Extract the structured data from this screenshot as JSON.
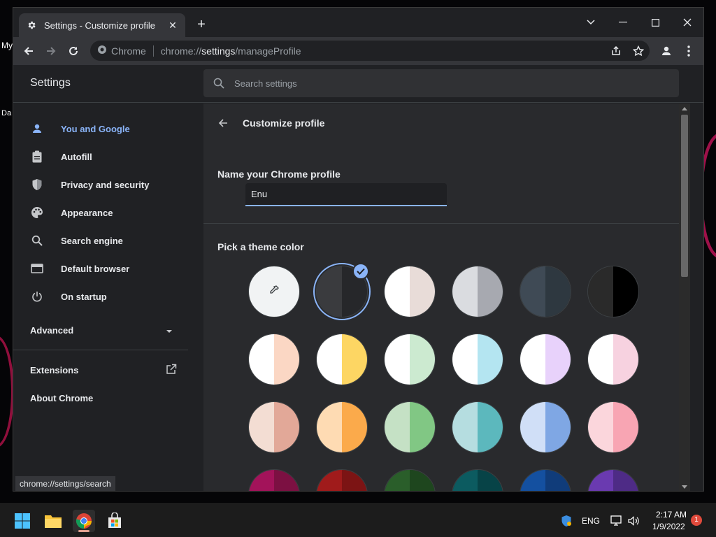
{
  "desktop": {
    "label_a": "My",
    "label_b": "Da"
  },
  "browser": {
    "tab_title": "Settings - Customize profile",
    "omnibox_site": "Chrome",
    "url_scheme": "chrome://",
    "url_host": "settings",
    "url_path": "/manageProfile"
  },
  "settings": {
    "title": "Settings",
    "search_placeholder": "Search settings",
    "nav": [
      {
        "label": "You and Google",
        "icon": "person-icon",
        "active": true
      },
      {
        "label": "Autofill",
        "icon": "clipboard-icon"
      },
      {
        "label": "Privacy and security",
        "icon": "shield-icon"
      },
      {
        "label": "Appearance",
        "icon": "palette-icon"
      },
      {
        "label": "Search engine",
        "icon": "search-icon"
      },
      {
        "label": "Default browser",
        "icon": "browser-icon"
      },
      {
        "label": "On startup",
        "icon": "power-icon"
      }
    ],
    "advanced_label": "Advanced",
    "extensions_label": "Extensions",
    "about_label": "About Chrome",
    "status_url": "chrome://settings/search"
  },
  "page": {
    "heading": "Customize profile",
    "name_label": "Name your Chrome profile",
    "name_value": "Enu",
    "theme_label": "Pick a theme color",
    "swatches": [
      [
        "picker",
        "#ffffff"
      ],
      [
        "#3a3b3e",
        "#26272a"
      ],
      [
        "#ffffff",
        "#e8dcd8"
      ],
      [
        "#dadce0",
        "#a7a9b0"
      ],
      [
        "#3f4a55",
        "#2e3840"
      ],
      [
        "#2a2a2a",
        "#000000"
      ],
      [
        "#ffffff",
        "#fbd7c4"
      ],
      [
        "#ffffff",
        "#fdd663"
      ],
      [
        "#ffffff",
        "#ccead0"
      ],
      [
        "#ffffff",
        "#b4e5f1"
      ],
      [
        "#ffffff",
        "#e8d2fb"
      ],
      [
        "#ffffff",
        "#f7d2e0"
      ],
      [
        "#f3ddd3",
        "#e2a898"
      ],
      [
        "#fedbb3",
        "#fbaa4b"
      ],
      [
        "#c5e1c5",
        "#81c784"
      ],
      [
        "#b5dde0",
        "#5cb8bd"
      ],
      [
        "#d0dff7",
        "#7fa7e4"
      ],
      [
        "#fbd6dc",
        "#f8a5b3"
      ],
      [
        "#a3135a",
        "#7c1042"
      ],
      [
        "#a01b1b",
        "#7c1414"
      ],
      [
        "#2a5e2a",
        "#1e461e"
      ],
      [
        "#0c5b60",
        "#074347"
      ],
      [
        "#1450a0",
        "#103c7a"
      ],
      [
        "#6a3ab0",
        "#4e2b86"
      ]
    ],
    "selected_swatch_index": 1
  },
  "taskbar": {
    "lang": "ENG",
    "time": "2:17 AM",
    "date": "1/9/2022",
    "notification_count": "1"
  }
}
